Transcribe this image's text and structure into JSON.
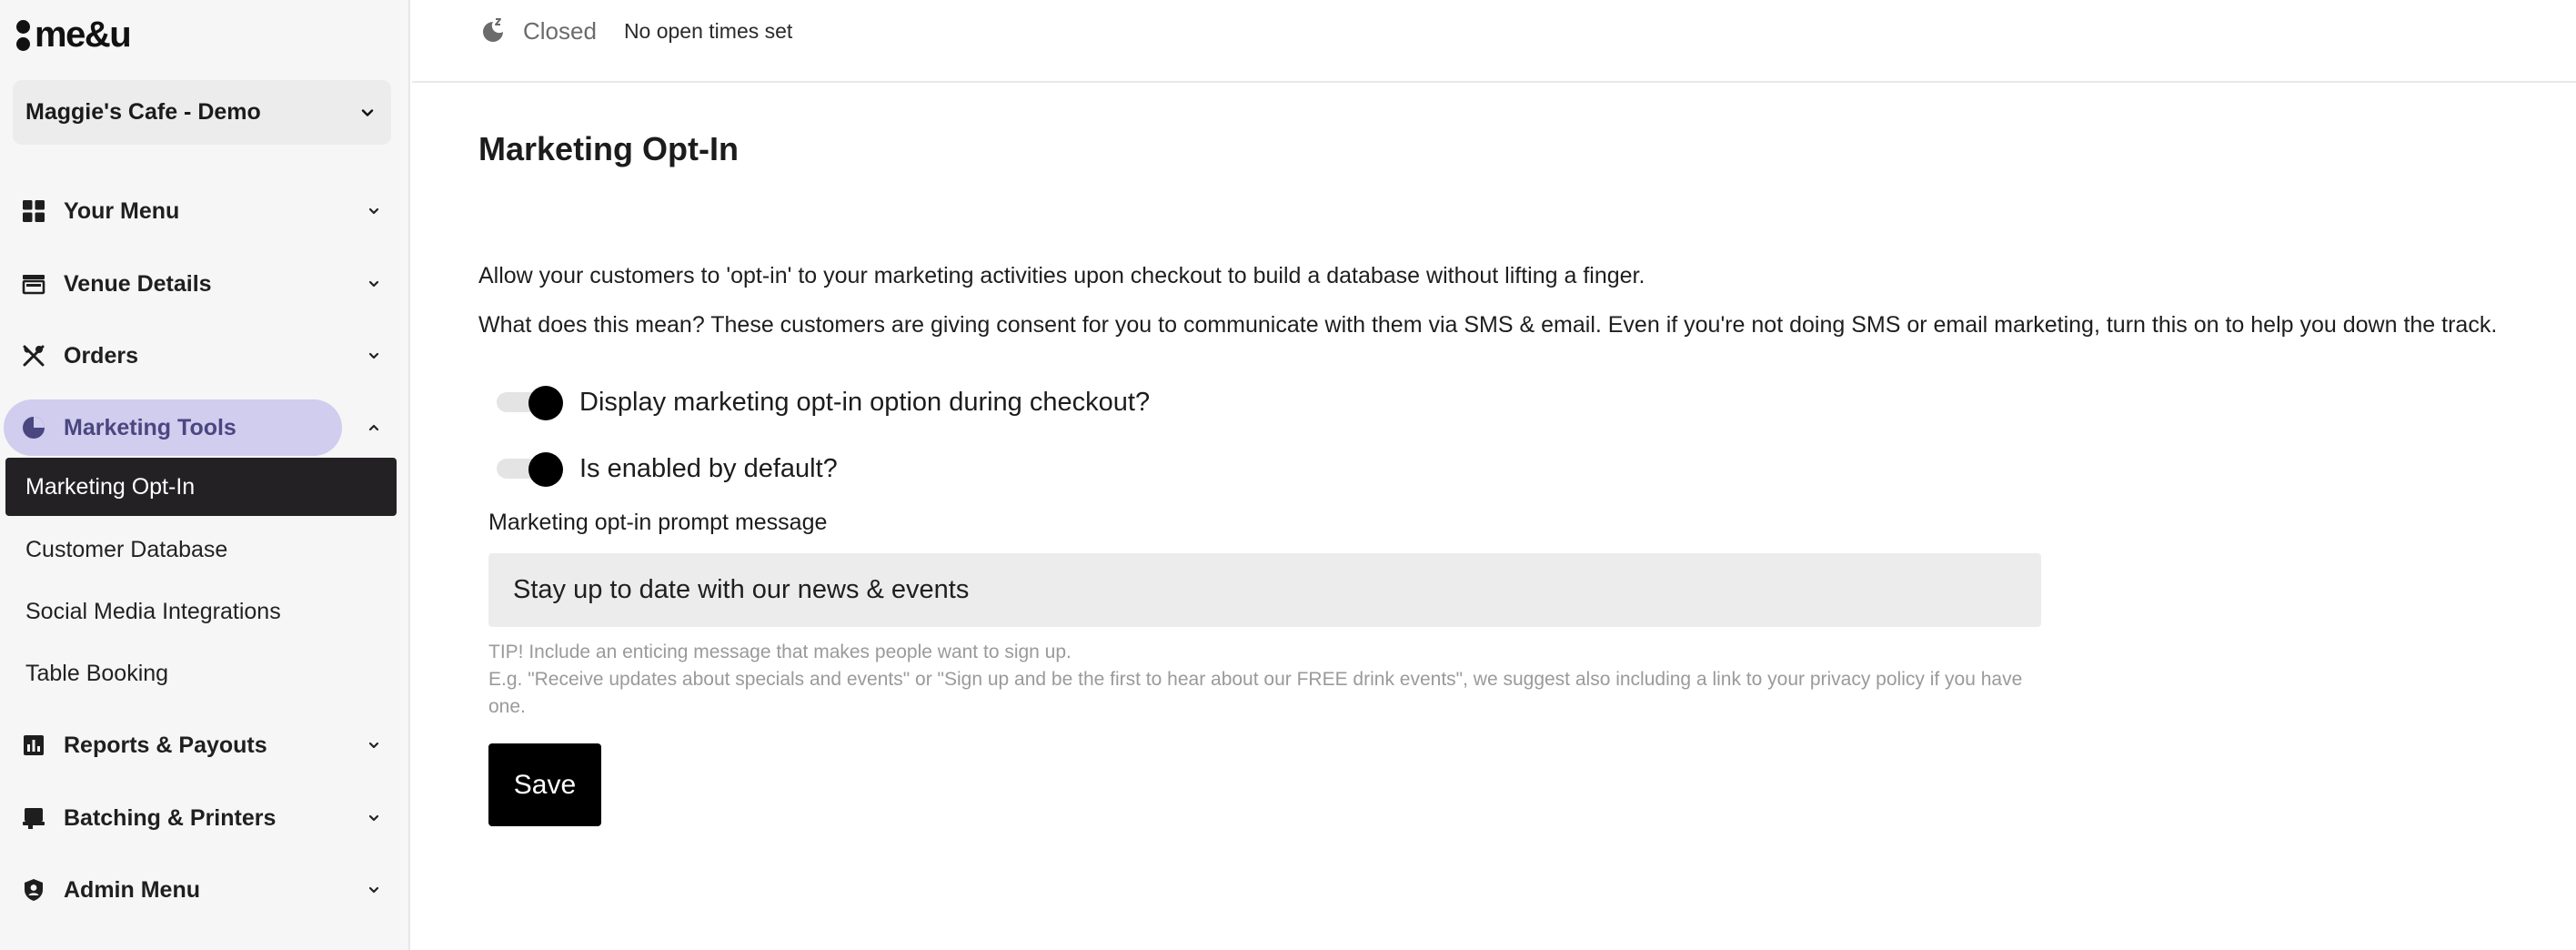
{
  "brand": {
    "name": "me&u"
  },
  "venue": {
    "selected": "Maggie's Cafe - Demo"
  },
  "sidebar": {
    "items": [
      {
        "label": "Your Menu",
        "icon": "grid-icon",
        "expanded": false
      },
      {
        "label": "Venue Details",
        "icon": "storefront-icon",
        "expanded": false
      },
      {
        "label": "Orders",
        "icon": "utensils-icon",
        "expanded": false
      },
      {
        "label": "Marketing Tools",
        "icon": "pie-chart-icon",
        "expanded": true
      },
      {
        "label": "Reports & Payouts",
        "icon": "bar-chart-icon",
        "expanded": false
      },
      {
        "label": "Batching & Printers",
        "icon": "printer-icon",
        "expanded": false
      },
      {
        "label": "Admin Menu",
        "icon": "shield-user-icon",
        "expanded": false
      }
    ],
    "marketing_subitems": [
      {
        "label": "Marketing Opt-In",
        "selected": true
      },
      {
        "label": "Customer Database",
        "selected": false
      },
      {
        "label": "Social Media Integrations",
        "selected": false
      },
      {
        "label": "Table Booking",
        "selected": false
      }
    ]
  },
  "topbar": {
    "status_icon": "moon-sleep-icon",
    "status": "Closed",
    "hours": "No open times set"
  },
  "main": {
    "title": "Marketing Opt-In",
    "description_1": "Allow your customers to 'opt-in' to your marketing activities upon checkout to build a database without lifting a finger.",
    "description_2": "What does this mean? These customers are giving consent for you to communicate with them via SMS & email. Even if you're not doing SMS or email marketing, turn this on to help you down the track.",
    "toggles": [
      {
        "label": "Display marketing opt-in option during checkout?",
        "on": true
      },
      {
        "label": "Is enabled by default?",
        "on": true
      }
    ],
    "prompt_label": "Marketing opt-in prompt message",
    "prompt_value": "Stay up to date with our news & events",
    "tip_line_1": "TIP! Include an enticing message that makes people want to sign up.",
    "tip_line_2": "E.g. \"Receive updates about specials and events\" or \"Sign up and be the first to hear about our FREE drink events\", we suggest also including a link to your privacy policy if you have one.",
    "save_label": "Save"
  },
  "colors": {
    "active_nav_bg": "#d0cdee",
    "active_nav_text": "#4a4680",
    "selected_subitem_bg": "#242124",
    "button_bg": "#000000",
    "input_bg": "#ececec",
    "sidebar_bg": "#f6f6f6"
  }
}
